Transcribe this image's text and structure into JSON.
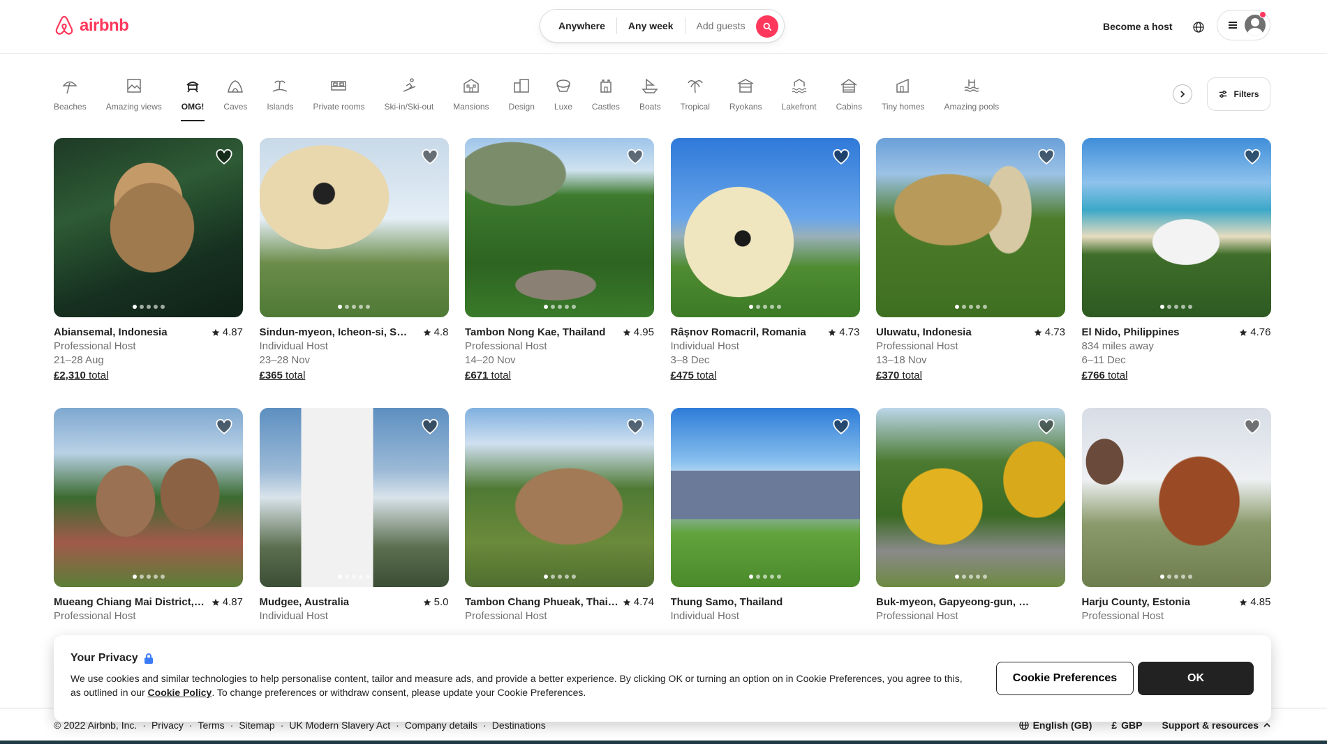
{
  "header": {
    "logo_text": "airbnb",
    "search": {
      "anywhere": "Anywhere",
      "any_week": "Any week",
      "add_guests": "Add guests"
    },
    "become_host": "Become a host"
  },
  "categories": [
    {
      "label": "Beaches",
      "icon": "beach-umbrella-icon"
    },
    {
      "label": "Amazing views",
      "icon": "amazing-views-icon"
    },
    {
      "label": "OMG!",
      "icon": "omg-house-icon",
      "active": true
    },
    {
      "label": "Caves",
      "icon": "cave-icon"
    },
    {
      "label": "Islands",
      "icon": "island-icon"
    },
    {
      "label": "Private rooms",
      "icon": "private-room-icon"
    },
    {
      "label": "Ski-in/Ski-out",
      "icon": "ski-icon"
    },
    {
      "label": "Mansions",
      "icon": "mansion-icon"
    },
    {
      "label": "Design",
      "icon": "design-icon"
    },
    {
      "label": "Luxe",
      "icon": "luxe-icon"
    },
    {
      "label": "Castles",
      "icon": "castle-icon"
    },
    {
      "label": "Boats",
      "icon": "boat-icon"
    },
    {
      "label": "Tropical",
      "icon": "palm-tree-icon"
    },
    {
      "label": "Ryokans",
      "icon": "ryokan-icon"
    },
    {
      "label": "Lakefront",
      "icon": "lakefront-icon"
    },
    {
      "label": "Cabins",
      "icon": "cabin-icon"
    },
    {
      "label": "Tiny homes",
      "icon": "tiny-home-icon"
    },
    {
      "label": "Amazing pools",
      "icon": "pool-icon"
    }
  ],
  "filters_label": "Filters",
  "listings": [
    {
      "location": "Abiansemal, Indonesia",
      "rating": "4.87",
      "host": "Professional Host",
      "dates": "21–28 Aug",
      "price": "£2,310",
      "price_suffix": "total"
    },
    {
      "location": "Sindun-myeon, Icheon-si, South Korea",
      "rating": "4.8",
      "host": "Individual Host",
      "dates": "23–28 Nov",
      "price": "£365",
      "price_suffix": "total"
    },
    {
      "location": "Tambon Nong Kae, Thailand",
      "rating": "4.95",
      "host": "Professional Host",
      "dates": "14–20 Nov",
      "price": "£671",
      "price_suffix": "total"
    },
    {
      "location": "Râșnov Romacril, Romania",
      "rating": "4.73",
      "host": "Individual Host",
      "dates": "3–8 Dec",
      "price": "£475",
      "price_suffix": "total"
    },
    {
      "location": "Uluwatu, Indonesia",
      "rating": "4.73",
      "host": "Professional Host",
      "dates": "13–18 Nov",
      "price": "£370",
      "price_suffix": "total"
    },
    {
      "location": "El Nido, Philippines",
      "rating": "4.76",
      "host": "834 miles away",
      "dates": "6–11 Dec",
      "price": "£766",
      "price_suffix": "total"
    },
    {
      "location": "Mueang Chiang Mai District, Thailand",
      "rating": "4.87",
      "host": "Professional Host",
      "dates": "",
      "price": "",
      "price_suffix": ""
    },
    {
      "location": "Mudgee, Australia",
      "rating": "5.0",
      "host": "Individual Host",
      "dates": "",
      "price": "",
      "price_suffix": ""
    },
    {
      "location": "Tambon Chang Phueak, Thailand",
      "rating": "4.74",
      "host": "Professional Host",
      "dates": "",
      "price": "",
      "price_suffix": ""
    },
    {
      "location": "Thung Samo, Thailand",
      "rating": "",
      "host": "Individual Host",
      "dates": "",
      "price": "",
      "price_suffix": ""
    },
    {
      "location": "Buk-myeon, Gapyeong-gun, South Korea",
      "rating": "",
      "host": "Professional Host",
      "dates": "",
      "price": "",
      "price_suffix": ""
    },
    {
      "location": "Harju County, Estonia",
      "rating": "4.85",
      "host": "Professional Host",
      "dates": "",
      "price": "",
      "price_suffix": ""
    }
  ],
  "cookie": {
    "title": "Your Privacy",
    "text_before": "We use cookies and similar technologies to help personalise content, tailor and measure ads, and provide a better experience. By clicking OK or turning an option on in Cookie Preferences, you agree to this, as outlined in our ",
    "policy_link": "Cookie Policy",
    "text_after": ". To change preferences or withdraw consent, please update your Cookie Preferences.",
    "pref_button": "Cookie Preferences",
    "ok_button": "OK"
  },
  "footer": {
    "copyright": "© 2022 Airbnb, Inc.",
    "links": [
      "Privacy",
      "Terms",
      "Sitemap",
      "UK Modern Slavery Act",
      "Company details",
      "Destinations"
    ],
    "language": "English (GB)",
    "currency_symbol": "£",
    "currency": "GBP",
    "support": "Support & resources"
  },
  "colors": {
    "brand": "#ff385c",
    "text": "#222222",
    "muted": "#717171"
  }
}
